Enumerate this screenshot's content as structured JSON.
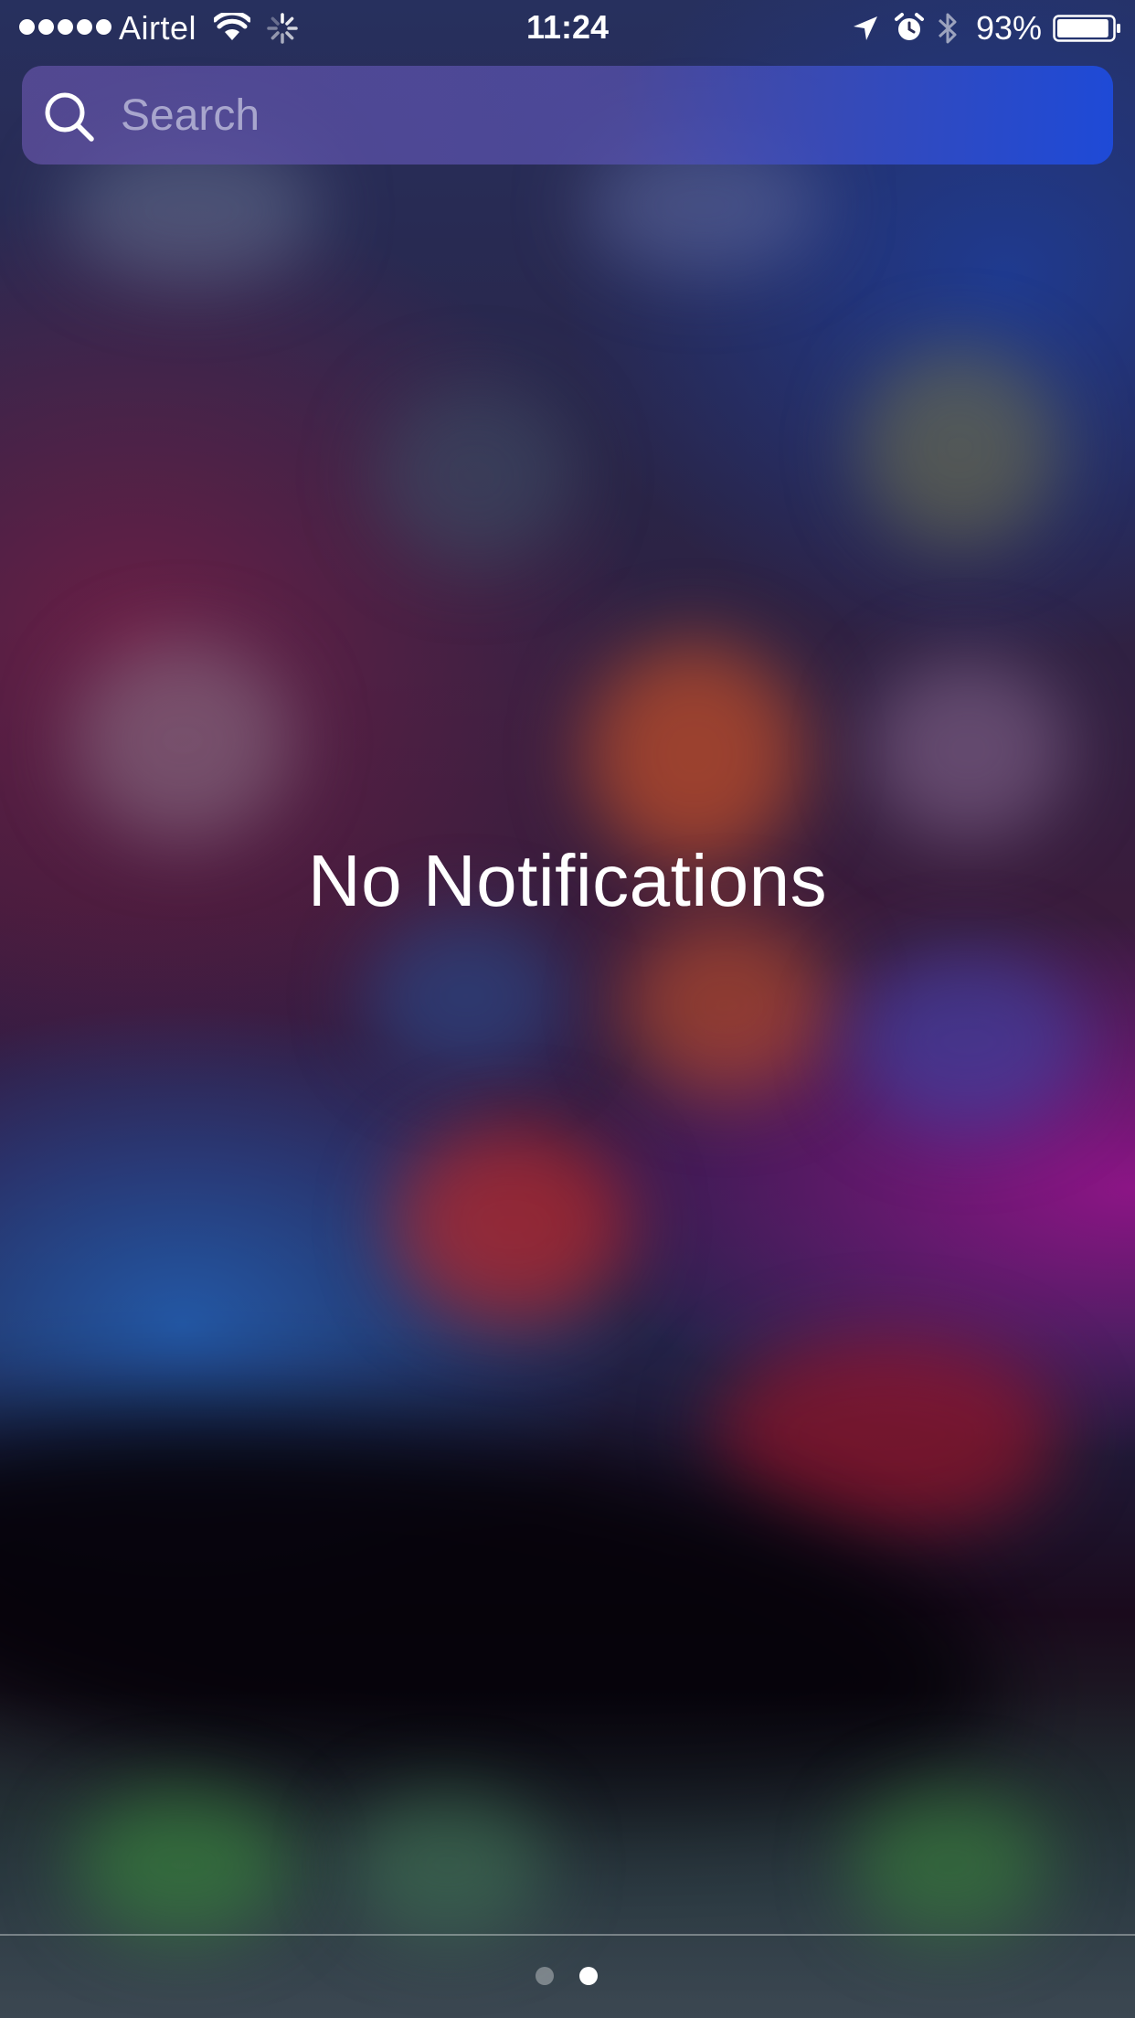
{
  "status_bar": {
    "carrier": "Airtel",
    "time": "11:24",
    "battery_percent": "93%",
    "battery_level": 0.93,
    "signal_bars": 5,
    "icons": [
      "wifi-icon",
      "activity-spinner-icon",
      "location-arrow-icon",
      "alarm-clock-icon",
      "bluetooth-icon",
      "battery-icon"
    ]
  },
  "search": {
    "placeholder": "Search",
    "value": ""
  },
  "main": {
    "message": "No Notifications"
  },
  "page_indicator": {
    "pages": 2,
    "current_page": 2
  },
  "colors": {
    "search_bar_start": "#5f50a0",
    "search_bar_end": "#1e4bdc",
    "text": "#ffffff"
  }
}
